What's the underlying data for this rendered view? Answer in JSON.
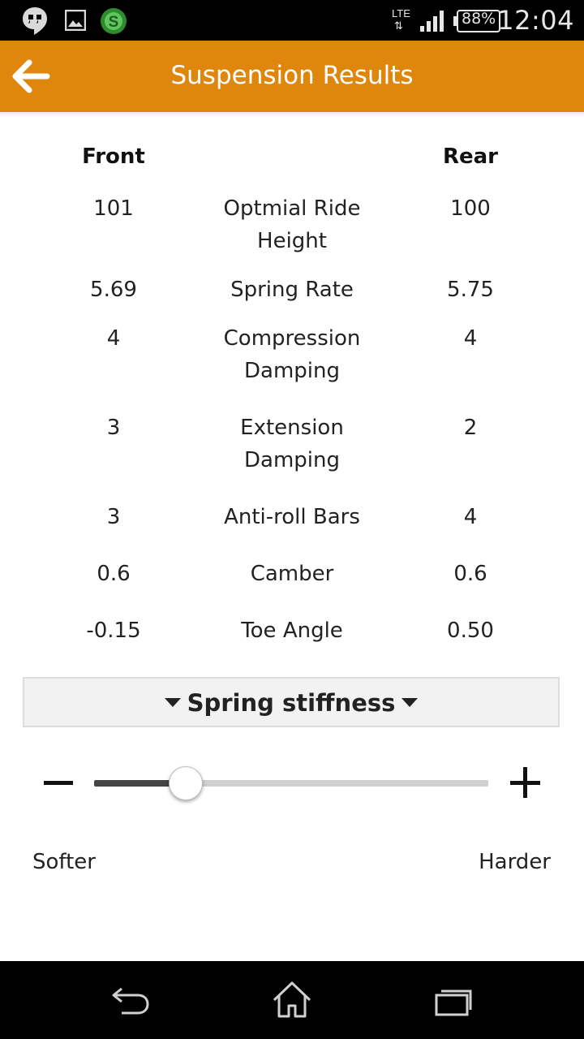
{
  "status_bar": {
    "network": "LTE",
    "battery": "88%",
    "time": "12:04",
    "icons": [
      "hangouts-icon",
      "gallery-icon",
      "swiftkey-icon",
      "lte-icon",
      "signal-icon",
      "battery-icon"
    ]
  },
  "action_bar": {
    "title": "Suspension Results",
    "back_icon": "arrow-left-icon",
    "color": "#df870d"
  },
  "results": {
    "headers": {
      "front": "Front",
      "rear": "Rear"
    },
    "rows": [
      {
        "front": "101",
        "label": "Optmial Ride Height",
        "rear": "100"
      },
      {
        "front": "5.69",
        "label": "Spring Rate",
        "rear": "5.75"
      },
      {
        "front": "4",
        "label": "Compression Damping",
        "rear": "4"
      },
      {
        "front": "3",
        "label": "Extension Damping",
        "rear": "2"
      },
      {
        "front": "3",
        "label": "Anti-roll Bars",
        "rear": "4"
      },
      {
        "front": "0.6",
        "label": "Camber",
        "rear": "0.6"
      },
      {
        "front": "-0.15",
        "label": "Toe Angle",
        "rear": "0.50"
      }
    ]
  },
  "adjuster": {
    "selected": "Spring stiffness",
    "slider_fraction": 0.23,
    "min_label": "Softer",
    "max_label": "Harder"
  },
  "nav_bar": {
    "icons": [
      "back-nav-icon",
      "home-icon",
      "recents-icon"
    ]
  }
}
